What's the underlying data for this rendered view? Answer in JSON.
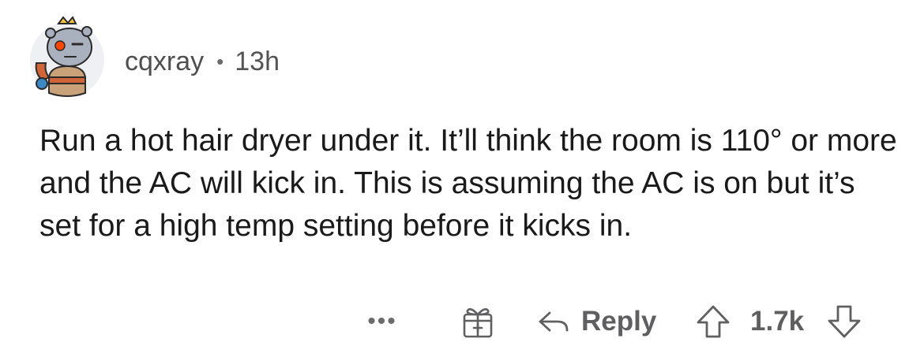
{
  "comment": {
    "username": "cqxray",
    "separator": "•",
    "age": "13h",
    "text": "Run a hot hair dryer under it. It’ll think the room is 110° or more and the AC will kick in. This is assuming the AC is on but it’s set for a high temp setting before it kicks in."
  },
  "actions": {
    "more_label": "•••",
    "reply_label": "Reply",
    "score": "1.7k"
  },
  "icons": {
    "avatar": "snoo-avatar-icon",
    "award": "gift-icon",
    "reply": "reply-arrow-icon",
    "upvote": "upvote-arrow-icon",
    "downvote": "downvote-arrow-icon"
  },
  "colors": {
    "text": "#1a1a1b",
    "meta": "#4f4f50",
    "icon": "#606062"
  }
}
